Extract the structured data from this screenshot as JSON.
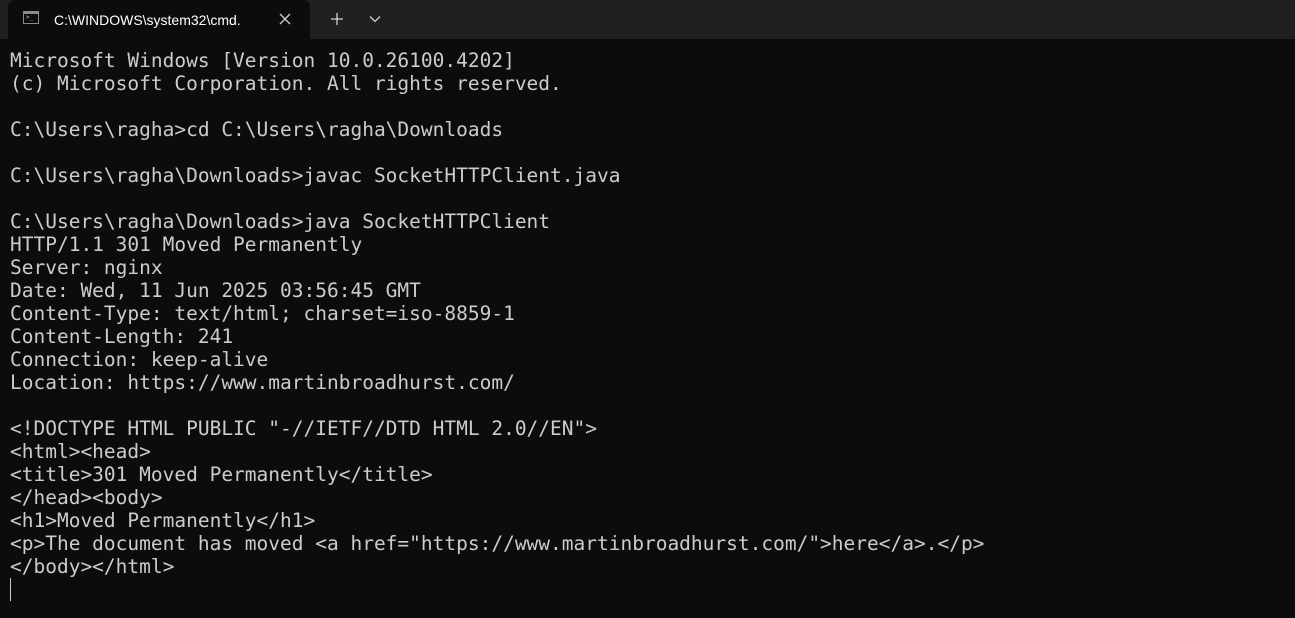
{
  "tab": {
    "title": "C:\\WINDOWS\\system32\\cmd.",
    "icon": "terminal-icon",
    "close_icon": "close-icon"
  },
  "toolbar": {
    "new_tab_icon": "plus-icon",
    "dropdown_icon": "chevron-down-icon"
  },
  "colors": {
    "background": "#0c0c0c",
    "titlebar": "#202020",
    "text": "#cccccc"
  },
  "terminal": {
    "lines": [
      "Microsoft Windows [Version 10.0.26100.4202]",
      "(c) Microsoft Corporation. All rights reserved.",
      "",
      "C:\\Users\\ragha>cd C:\\Users\\ragha\\Downloads",
      "",
      "C:\\Users\\ragha\\Downloads>javac SocketHTTPClient.java",
      "",
      "C:\\Users\\ragha\\Downloads>java SocketHTTPClient",
      "HTTP/1.1 301 Moved Permanently",
      "Server: nginx",
      "Date: Wed, 11 Jun 2025 03:56:45 GMT",
      "Content-Type: text/html; charset=iso-8859-1",
      "Content-Length: 241",
      "Connection: keep-alive",
      "Location: https://www.martinbroadhurst.com/",
      "",
      "<!DOCTYPE HTML PUBLIC \"-//IETF//DTD HTML 2.0//EN\">",
      "<html><head>",
      "<title>301 Moved Permanently</title>",
      "</head><body>",
      "<h1>Moved Permanently</h1>",
      "<p>The document has moved <a href=\"https://www.martinbroadhurst.com/\">here</a>.</p>",
      "</body></html>"
    ]
  }
}
